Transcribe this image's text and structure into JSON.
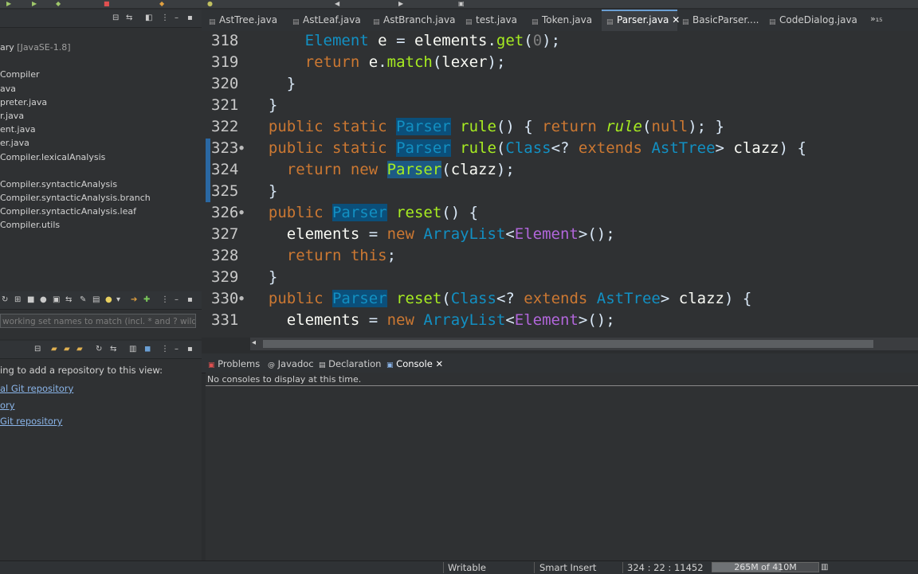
{
  "pkg_explorer": {
    "items": [
      {
        "label": "ary ",
        "lib": "[JavaSE-1.8]"
      },
      {
        "label": "",
        "lib": ""
      },
      {
        "label": "Compiler",
        "lib": ""
      },
      {
        "label": "ava",
        "lib": ""
      },
      {
        "label": "preter.java",
        "lib": ""
      },
      {
        "label": "r.java",
        "lib": ""
      },
      {
        "label": "ent.java",
        "lib": ""
      },
      {
        "label": "er.java",
        "lib": ""
      },
      {
        "label": "Compiler.lexicalAnalysis",
        "lib": ""
      },
      {
        "label": "",
        "lib": ""
      },
      {
        "label": "Compiler.syntacticAnalysis",
        "lib": ""
      },
      {
        "label": "Compiler.syntacticAnalysis.branch",
        "lib": ""
      },
      {
        "label": "Compiler.syntacticAnalysis.leaf",
        "lib": ""
      },
      {
        "label": "Compiler.utils",
        "lib": ""
      }
    ]
  },
  "filter": {
    "placeholder": "working set names to match (incl. * and ? wild"
  },
  "git": {
    "hint": "ing to add a repository to this view:",
    "links": [
      "al Git repository",
      "ory",
      "Git repository"
    ]
  },
  "tabs": [
    {
      "label": "AstTree.java"
    },
    {
      "label": "AstLeaf.java"
    },
    {
      "label": "AstBranch.java"
    },
    {
      "label": "test.java"
    },
    {
      "label": "Token.java"
    },
    {
      "label": "Parser.java",
      "close": "✕"
    },
    {
      "label": "BasicParser...."
    },
    {
      "label": "CodeDialog.java"
    },
    {
      "label": "»₁₅"
    }
  ],
  "editor": {
    "line_numbers": [
      "318",
      "319",
      "320",
      "321",
      "322",
      "323",
      "324",
      "325",
      "326",
      "327",
      "328",
      "329",
      "330",
      "331"
    ]
  },
  "bottom_tabs": [
    {
      "label": "Problems"
    },
    {
      "label": "Javadoc"
    },
    {
      "label": "Declaration"
    },
    {
      "label": "Console",
      "close": "✕"
    }
  ],
  "console": {
    "message": "No consoles to display at this time."
  },
  "status": {
    "mode": "Writable",
    "insert": "Smart Insert",
    "position": "324 : 22 : 11452",
    "heap": "265M of 410M",
    "heap_used_fraction": 0.65
  },
  "colors": {
    "keyword": "#cc7832",
    "type": "#1290c3",
    "method": "#a7ec21",
    "generic": "#b166da",
    "occurrence_bg": "#0b4f7a"
  }
}
